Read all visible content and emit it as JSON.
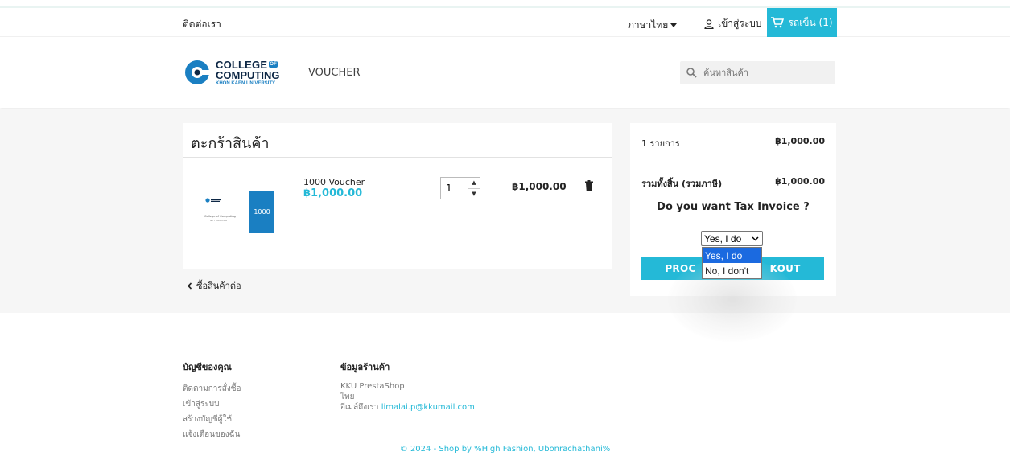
{
  "topbar": {
    "contact": "ติดต่อเรา",
    "language": "ภาษาไทย",
    "signin": "เข้าสู่ระบบ",
    "cart_label": "รถเข็น (1)"
  },
  "header": {
    "logo_line1": "COLLEGE",
    "logo_of": "OF",
    "logo_line2": "COMPUTING",
    "logo_line3": "KHON KAEN UNIVERSITY",
    "nav_voucher": "VOUCHER",
    "search_placeholder": "ค้นหาสินค้า"
  },
  "cart": {
    "title": "ตะกร้าสินค้า",
    "item": {
      "name": "1000 Voucher",
      "price": "฿1,000.00",
      "quantity": "1",
      "line_total": "฿1,000.00",
      "image_text_top": "College of Computing",
      "image_text_sub": "GIFT VOUCHER",
      "image_value": "1000"
    },
    "continue": "ซื้อสินค้าต่อ"
  },
  "summary": {
    "items_label": "1 รายการ",
    "items_value": "฿1,000.00",
    "total_label": "รวมทั้งสิ้น (รวมภาษี)",
    "total_value": "฿1,000.00",
    "tax_question": "Do you want Tax Invoice ?",
    "tax_select_value": "Yes, I do",
    "tax_options": [
      "Yes, I do",
      "No, I don't"
    ],
    "checkout_left": "PROC",
    "checkout_right": "KOUT"
  },
  "footer": {
    "account_title": "บัญชีของคุณ",
    "account_links": [
      "ติดตามการสั่งซื้อ",
      "เข้าสู่ระบบ",
      "สร้างบัญชีผู้ใช้",
      "แจ้งเตือนของฉัน"
    ],
    "store_title": "ข้อมูลร้านค้า",
    "store_name": "KKU PrestaShop",
    "store_country": "ไทย",
    "store_email_label": "อีเมล์ถึงเรา",
    "store_email": "limalai.p@kkumail.com",
    "copyright": "© 2024 - Shop by %High Fashion, Ubonrachathani%"
  },
  "colors": {
    "accent": "#24b9d7",
    "select_highlight": "#1b6ae0",
    "background_main": "#f6f6f6"
  }
}
